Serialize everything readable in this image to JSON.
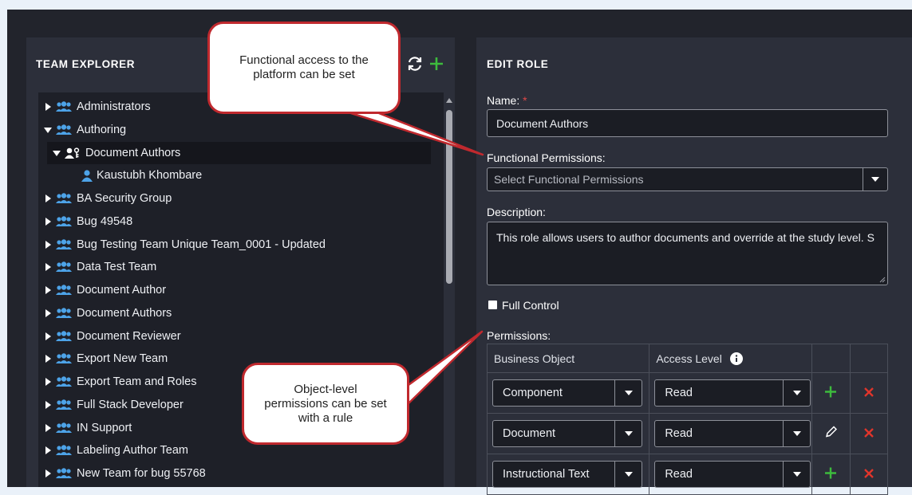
{
  "team_explorer": {
    "title": "TEAM EXPLORER",
    "refresh_icon": "refresh-icon",
    "add_icon": "plus-icon",
    "items": [
      {
        "label": "Administrators",
        "type": "group",
        "expanded": false
      },
      {
        "label": "Authoring",
        "type": "group",
        "expanded": true
      },
      {
        "label": "Document Authors",
        "type": "role",
        "expanded": true,
        "selected": true
      },
      {
        "label": "Kaustubh Khombare",
        "type": "user"
      },
      {
        "label": "BA Security Group",
        "type": "group",
        "expanded": false
      },
      {
        "label": "Bug 49548",
        "type": "group",
        "expanded": false
      },
      {
        "label": "Bug Testing Team Unique Team_0001 - Updated",
        "type": "group",
        "expanded": false
      },
      {
        "label": "Data Test Team",
        "type": "group",
        "expanded": false
      },
      {
        "label": "Document Author",
        "type": "group",
        "expanded": false
      },
      {
        "label": "Document Authors",
        "type": "group",
        "expanded": false
      },
      {
        "label": "Document Reviewer",
        "type": "group",
        "expanded": false
      },
      {
        "label": "Export New Team",
        "type": "group",
        "expanded": false
      },
      {
        "label": "Export Team and Roles",
        "type": "group",
        "expanded": false
      },
      {
        "label": "Full Stack Developer",
        "type": "group",
        "expanded": false
      },
      {
        "label": "IN Support",
        "type": "group",
        "expanded": false
      },
      {
        "label": "Labeling Author Team",
        "type": "group",
        "expanded": false
      },
      {
        "label": "New Team for bug 55768",
        "type": "group",
        "expanded": false
      }
    ]
  },
  "edit_role": {
    "title": "EDIT ROLE",
    "name_label": "Name:",
    "required_mark": "*",
    "name_value": "Document Authors",
    "functional_permissions_label": "Functional Permissions:",
    "functional_permissions_placeholder": "Select Functional Permissions",
    "description_label": "Description:",
    "description_value": "This role allows users to author documents and override at the study level. S",
    "full_control_label": "Full Control",
    "full_control_checked": false,
    "permissions_label": "Permissions:",
    "table": {
      "headers": [
        "Business Object",
        "Access Level"
      ],
      "info_icon": "info-icon",
      "rows": [
        {
          "object": "Component",
          "access": "Read",
          "action": "add"
        },
        {
          "object": "Document",
          "access": "Read",
          "action": "edit"
        },
        {
          "object": "Instructional Text",
          "access": "Read",
          "action": "add"
        }
      ]
    }
  },
  "callouts": {
    "functional": "Functional access to the platform can be set",
    "object_level": "Object-level permissions can be set with a rule"
  },
  "colors": {
    "accent_green": "#3dbb3d",
    "danger_red": "#e0352b",
    "callout_border": "#c0292e",
    "group_icon": "#4da3e8"
  }
}
